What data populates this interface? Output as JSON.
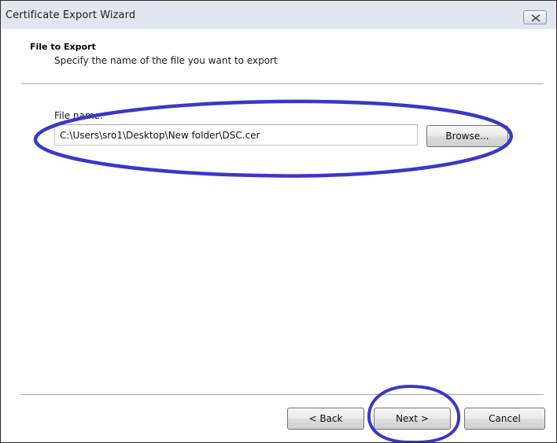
{
  "window": {
    "title": "Certificate Export Wizard"
  },
  "header": {
    "title": "File to Export",
    "description": "Specify the name of the file you want to export"
  },
  "form": {
    "file_name_label": "File name:",
    "file_name_value": "C:\\Users\\sro1\\Desktop\\New folder\\DSC.cer",
    "browse_label": "Browse..."
  },
  "footer": {
    "back_label": "< Back",
    "next_label": "Next >",
    "cancel_label": "Cancel"
  },
  "icons": {
    "close": "close-icon"
  },
  "colors": {
    "annotation": "#3838c8",
    "titlebar": "#dfe7f0"
  }
}
